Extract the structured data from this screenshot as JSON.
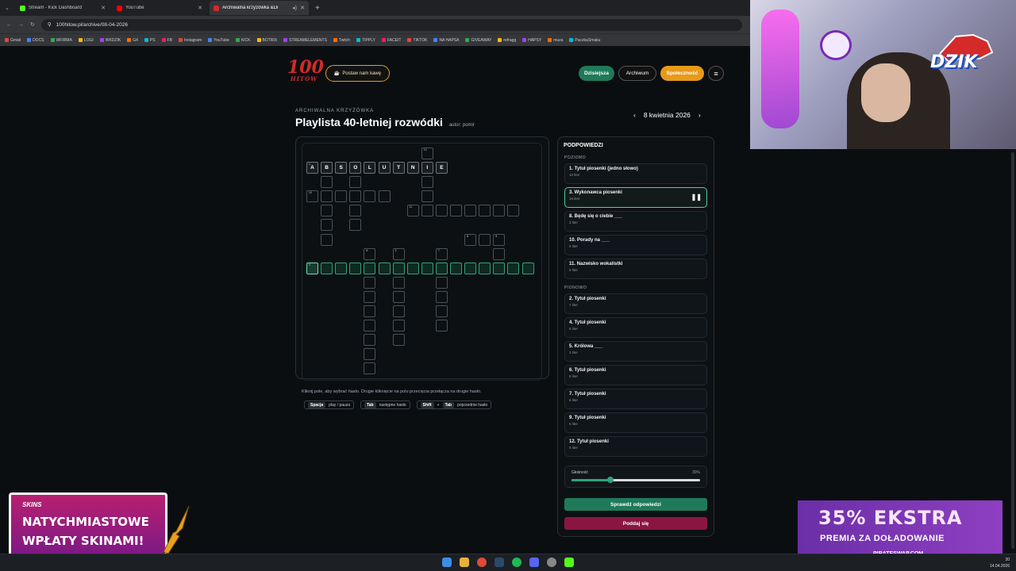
{
  "browser": {
    "tabs": [
      {
        "label": "Stream - Kick Dashboard",
        "color": "#53fc18"
      },
      {
        "label": "YouTube",
        "color": "#ff0000"
      },
      {
        "label": "Archiwalna krzyżówka &Di",
        "color": "#d42a2a"
      }
    ],
    "url": "100hitow.pl/archive/08-04-2026",
    "bookmarks": [
      "Gmail",
      "DOCS",
      "WFIRMA",
      "LOGI",
      "WKDZIK",
      "G4",
      "PS",
      "FB",
      "Instagram",
      "YouTube",
      "KICK",
      "BOTRIX",
      "STREAMELEMENTS",
      "Twitch",
      "TIPPLY",
      "FACEIT",
      "TIKTOK",
      "NA HAPSA",
      "GIVEAWAY",
      "refragg",
      "HAPSY",
      "muza",
      "PaczkaSmaku"
    ]
  },
  "header": {
    "logo_top": "100",
    "logo_bottom": "HITÓW",
    "coffee_label": "Postaw nam kawę",
    "nav": {
      "today": "Dzisiejsza",
      "archive": "Archiwum",
      "community": "Społeczność"
    }
  },
  "puzzle": {
    "kicker": "ARCHIWALNA KRZYŻÓWKA",
    "title": "Playlista 40-letniej rozwódki",
    "author": "autor: pomir",
    "date": "8 kwietnia 2026",
    "hint": "Kliknij pole, aby wybrać hasło. Drugie kliknięcie na polu przecięcia przełącza na drugie hasło.",
    "keys": [
      {
        "keys": [
          "Spacja"
        ],
        "desc": "play / pauza"
      },
      {
        "keys": [
          "Tab"
        ],
        "desc": "następne hasło"
      },
      {
        "keys": [
          "Shift",
          "Tab"
        ],
        "desc": "poprzednie hasło"
      }
    ],
    "filled_word": [
      "A",
      "B",
      "S",
      "O",
      "L",
      "U",
      "T",
      "N",
      "I",
      "E"
    ]
  },
  "clues": {
    "title": "PODPOWIEDZI",
    "across_label": "POZIOMO",
    "down_label": "PIONOWO",
    "across": [
      {
        "title": "1. Tytuł piosenki (jedno słowo)",
        "sub": "10 liter"
      },
      {
        "title": "3. Wykonawca piosenki",
        "sub": "16 liter",
        "active": true
      },
      {
        "title": "8. Będę się o ciebie ___",
        "sub": "3 liter"
      },
      {
        "title": "10. Porady na ___",
        "sub": "6 liter"
      },
      {
        "title": "11. Nazwisko wokalistki",
        "sub": "8 liter"
      }
    ],
    "down": [
      {
        "title": "2. Tytuł piosenki",
        "sub": "7 liter"
      },
      {
        "title": "4. Tytuł piosenki",
        "sub": "8 liter"
      },
      {
        "title": "5. Królowa ___",
        "sub": "3 liter"
      },
      {
        "title": "6. Tytuł piosenki",
        "sub": "9 liter"
      },
      {
        "title": "7. Tytuł piosenki",
        "sub": "6 liter"
      },
      {
        "title": "9. Tytuł piosenki",
        "sub": "5 liter"
      },
      {
        "title": "12. Tytuł piosenki",
        "sub": "5 liter"
      }
    ],
    "volume_label": "Głośność",
    "volume_value": "30%",
    "volume_fraction": 0.3,
    "check_label": "Sprawdź odpowiedzi",
    "giveup_label": "Poddaj się"
  },
  "overlay": {
    "dzik": "DZIK",
    "promo_left_brand": "SKINS",
    "promo_left_line1": "NATYCHMIASTOWE",
    "promo_left_line2": "WPŁATY SKINAMI!",
    "promo_right_big": "35% EKSTRA",
    "promo_right_small": "PREMIA ZA DOŁADOWANIE",
    "promo_right_site": "PIRATESWAP.COM"
  },
  "clock": {
    "time": "30",
    "date": "14.04.2026"
  }
}
